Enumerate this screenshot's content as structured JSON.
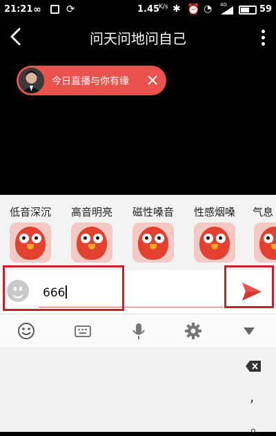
{
  "status_bar": {
    "time": "21:21",
    "speed": "1.45",
    "speed_unit": "K/s",
    "battery": "59",
    "signal_tag": "4G"
  },
  "header": {
    "title": "问天问地问自己"
  },
  "live_banner": {
    "text": "今日直播与你有缘"
  },
  "stickers": [
    {
      "label": "低音深沉",
      "icon": "owl-sticker-icon"
    },
    {
      "label": "高音明亮",
      "icon": "owl-sticker-icon"
    },
    {
      "label": "磁性嗓音",
      "icon": "owl-sticker-icon"
    },
    {
      "label": "性感烟嗓",
      "icon": "owl-sticker-icon"
    },
    {
      "label": "气息",
      "icon": "owl-sticker-icon"
    }
  ],
  "input": {
    "value": "666"
  },
  "toolbar": {
    "items": [
      "emoji-icon",
      "keyboard-icon",
      "microphone-icon",
      "gear-icon",
      "triangle-down-icon"
    ]
  },
  "keyboard": {
    "comma": ",",
    "period": "。"
  },
  "colors": {
    "accent": "#e9534b",
    "annotation": "#c8202a",
    "background": "#000000"
  }
}
